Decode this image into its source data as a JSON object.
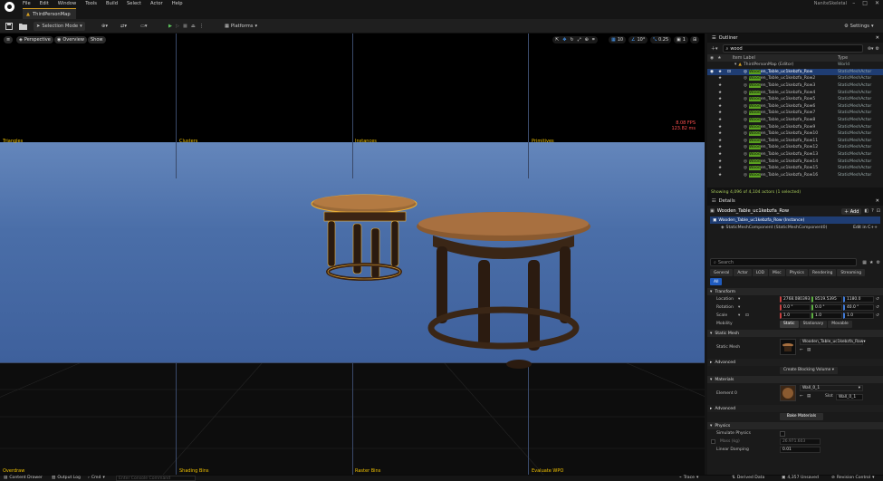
{
  "menubar": {
    "items": [
      "File",
      "Edit",
      "Window",
      "Tools",
      "Build",
      "Select",
      "Actor",
      "Help"
    ],
    "project_title": "NaniteSkeletal"
  },
  "tab": {
    "label": "ThirdPersonMap"
  },
  "toolbar": {
    "selection_mode": "Selection Mode",
    "platforms": "Platforms",
    "settings": "Settings"
  },
  "viewport": {
    "perspective": "Perspective",
    "overview": "Overview",
    "show": "Show",
    "grid_snap": "10",
    "rot_snap": "10°",
    "scale_snap": "0.25",
    "cam_speed": "1",
    "fps": "8.08 FPS",
    "ms": "123.82 ms",
    "labels_top": [
      "Triangles",
      "Clusters",
      "Instances",
      "Primitives"
    ],
    "labels_bottom": [
      "Overdraw",
      "Shading Bins",
      "Raster Bins",
      "Evaluate WPO"
    ]
  },
  "outliner": {
    "title": "Outliner",
    "search": "wood",
    "col_item": "Item Label",
    "col_type": "Type",
    "root": {
      "label": "ThirdPersonMap (Editor)",
      "type": "World"
    },
    "rows": [
      {
        "hl": "Wood",
        "rest": "en_Table_uc1kebzfa_Row",
        "type": "StaticMeshActor",
        "sel": true
      },
      {
        "hl": "Wood",
        "rest": "en_Table_uc1kebzfa_Row2",
        "type": "StaticMeshActor"
      },
      {
        "hl": "Wood",
        "rest": "en_Table_uc1kebzfa_Row3",
        "type": "StaticMeshActor"
      },
      {
        "hl": "Wood",
        "rest": "en_Table_uc1kebzfa_Row4",
        "type": "StaticMeshActor"
      },
      {
        "hl": "Wood",
        "rest": "en_Table_uc1kebzfa_Row5",
        "type": "StaticMeshActor"
      },
      {
        "hl": "Wood",
        "rest": "en_Table_uc1kebzfa_Row6",
        "type": "StaticMeshActor"
      },
      {
        "hl": "Wood",
        "rest": "en_Table_uc1kebzfa_Row7",
        "type": "StaticMeshActor"
      },
      {
        "hl": "Wood",
        "rest": "en_Table_uc1kebzfa_Row8",
        "type": "StaticMeshActor"
      },
      {
        "hl": "Wood",
        "rest": "en_Table_uc1kebzfa_Row9",
        "type": "StaticMeshActor"
      },
      {
        "hl": "Wood",
        "rest": "en_Table_uc1kebzfa_Row10",
        "type": "StaticMeshActor"
      },
      {
        "hl": "Wood",
        "rest": "en_Table_uc1kebzfa_Row11",
        "type": "StaticMeshActor"
      },
      {
        "hl": "Wood",
        "rest": "en_Table_uc1kebzfa_Row12",
        "type": "StaticMeshActor"
      },
      {
        "hl": "Wood",
        "rest": "en_Table_uc1kebzfa_Row13",
        "type": "StaticMeshActor"
      },
      {
        "hl": "Wood",
        "rest": "en_Table_uc1kebzfa_Row14",
        "type": "StaticMeshActor"
      },
      {
        "hl": "Wood",
        "rest": "en_Table_uc1kebzfa_Row15",
        "type": "StaticMeshActor"
      },
      {
        "hl": "Wood",
        "rest": "en_Table_uc1kebzfa_Row16",
        "type": "StaticMeshActor"
      }
    ],
    "status": "Showing 4,096 of 4,104 actors (1 selected)"
  },
  "details": {
    "title": "Details",
    "actor_name": "Wooden_Table_uc1kebzfa_Row",
    "add_label": "Add",
    "instance_row": "Wooden_Table_uc1kebzfa_Row (Instance)",
    "component_row": "StaticMeshComponent (StaticMeshComponent0)",
    "edit_cpp": "Edit in C++",
    "search_placeholder": "Search",
    "filters": [
      "General",
      "Actor",
      "LOD",
      "Misc",
      "Physics",
      "Rendering",
      "Streaming"
    ],
    "all_label": "All",
    "transform": {
      "header": "Transform",
      "location": "Location",
      "rotation": "Rotation",
      "scale": "Scale",
      "loc": [
        "2768.080393",
        "8519.5395",
        "1180.0"
      ],
      "rot": [
        "0.0 °",
        "0.0 °",
        "40.0 °"
      ],
      "scl": [
        "1.0",
        "1.0",
        "1.0"
      ],
      "mobility": "Mobility",
      "mob_opts": [
        "Static",
        "Stationary",
        "Movable"
      ]
    },
    "static_mesh": {
      "header": "Static Mesh",
      "label": "Static Mesh",
      "value": "Wooden_Table_uc1kebzfa_Raw",
      "advanced": "Advanced",
      "create_volume": "Create Blocking Volume"
    },
    "materials": {
      "header": "Materials",
      "element": "Element 0",
      "value": "Wall_0_1",
      "source_label": "Slot",
      "source_value": "Wall_0_1",
      "advanced": "Advanced",
      "bake": "Bake Materials"
    },
    "physics": {
      "header": "Physics",
      "simulate": "Simulate Physics",
      "mass": "Mass (kg)",
      "mass_val": "26.971.603",
      "linear_damping": "Linear Damping",
      "damping_val": "0.01"
    }
  },
  "statusbar": {
    "content_drawer": "Content Drawer",
    "output_log": "Output Log",
    "cmd": "Cmd",
    "console_placeholder": "Enter Console Command",
    "trace": "Trace",
    "derived": "Derived Data",
    "unsaved": "4,357 Unsaved",
    "revision": "Revision Control"
  }
}
